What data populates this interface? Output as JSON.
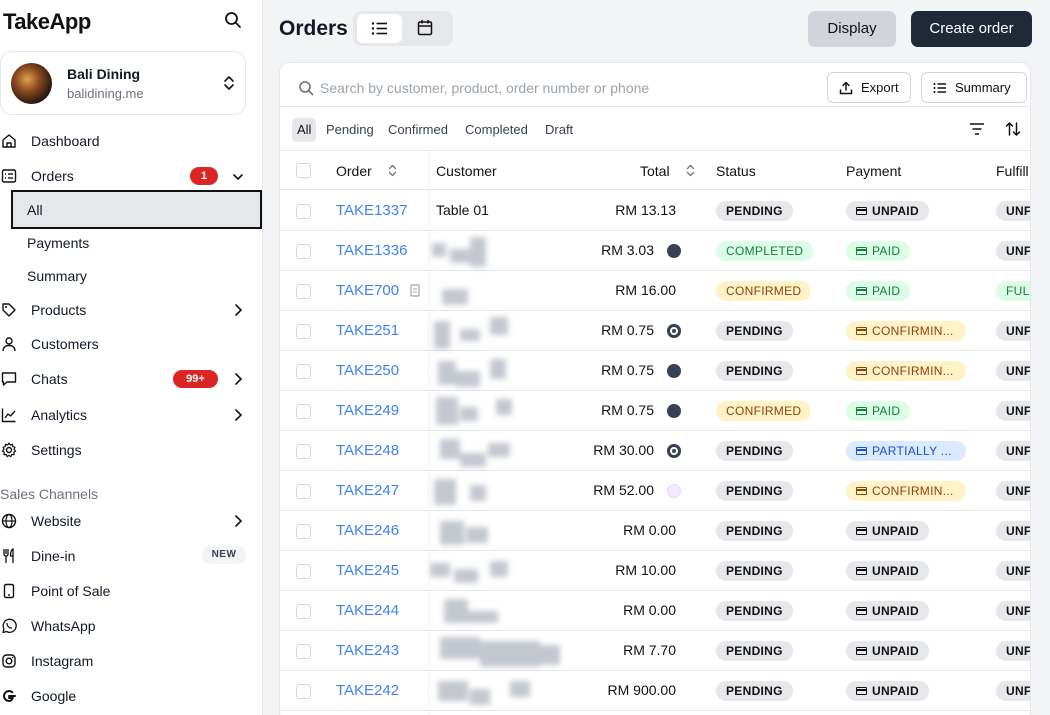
{
  "app": {
    "name": "TakeApp"
  },
  "store": {
    "name": "Bali Dining",
    "url": "balidining.me"
  },
  "nav": {
    "dashboard": "Dashboard",
    "orders": "Orders",
    "orders_badge": "1",
    "orders_sub": {
      "all": "All",
      "payments": "Payments",
      "summary": "Summary"
    },
    "products": "Products",
    "customers": "Customers",
    "chats": "Chats",
    "chats_badge": "99+",
    "analytics": "Analytics",
    "settings": "Settings"
  },
  "sales_channels": {
    "label": "Sales Channels",
    "website": "Website",
    "dinein": "Dine-in",
    "dinein_badge": "NEW",
    "pos": "Point of Sale",
    "whatsapp": "WhatsApp",
    "instagram": "Instagram",
    "google": "Google"
  },
  "header": {
    "title": "Orders",
    "display_label": "Display",
    "create_label": "Create order"
  },
  "search": {
    "placeholder": "Search by customer, product, order number or phone"
  },
  "toolbar": {
    "export_label": "Export",
    "summary_label": "Summary"
  },
  "filters": [
    "All",
    "Pending",
    "Confirmed",
    "Completed",
    "Draft"
  ],
  "columns": {
    "order": "Order",
    "customer": "Customer",
    "total": "Total",
    "status": "Status",
    "payment": "Payment",
    "fulfillment": "Fulfill"
  },
  "orders": [
    {
      "id": "TAKE1337",
      "customer": "Table 01",
      "total": "RM 13.13",
      "pm": "",
      "status": "PENDING",
      "payment": "UNPAID",
      "fulfillment": "UNF"
    },
    {
      "id": "TAKE1336",
      "customer": "",
      "total": "RM 3.03",
      "pm": "dark",
      "status": "COMPLETED",
      "payment": "PAID",
      "fulfillment": "UNF"
    },
    {
      "id": "TAKE700",
      "customer": "",
      "total": "RM 16.00",
      "pm": "",
      "status": "CONFIRMED",
      "payment": "PAID",
      "fulfillment": "FUL"
    },
    {
      "id": "TAKE251",
      "customer": "",
      "total": "RM 0.75",
      "pm": "eye",
      "status": "PENDING",
      "payment": "CONFIRMIN...",
      "fulfillment": "UNF"
    },
    {
      "id": "TAKE250",
      "customer": "",
      "total": "RM 0.75",
      "pm": "dark",
      "status": "PENDING",
      "payment": "CONFIRMIN...",
      "fulfillment": "UNF"
    },
    {
      "id": "TAKE249",
      "customer": "",
      "total": "RM 0.75",
      "pm": "dark",
      "status": "CONFIRMED",
      "payment": "PAID",
      "fulfillment": "UNF"
    },
    {
      "id": "TAKE248",
      "customer": "",
      "total": "RM 30.00",
      "pm": "eye",
      "status": "PENDING",
      "payment": "PARTIALLY ...",
      "fulfillment": "UNF"
    },
    {
      "id": "TAKE247",
      "customer": "",
      "total": "RM 52.00",
      "pm": "purple",
      "status": "PENDING",
      "payment": "CONFIRMIN...",
      "fulfillment": "UNF"
    },
    {
      "id": "TAKE246",
      "customer": "",
      "total": "RM 0.00",
      "pm": "",
      "status": "PENDING",
      "payment": "UNPAID",
      "fulfillment": "UNF"
    },
    {
      "id": "TAKE245",
      "customer": "",
      "total": "RM 10.00",
      "pm": "",
      "status": "PENDING",
      "payment": "UNPAID",
      "fulfillment": "UNF"
    },
    {
      "id": "TAKE244",
      "customer": "",
      "total": "RM 0.00",
      "pm": "",
      "status": "PENDING",
      "payment": "UNPAID",
      "fulfillment": "UNF"
    },
    {
      "id": "TAKE243",
      "customer": "",
      "total": "RM 7.70",
      "pm": "",
      "status": "PENDING",
      "payment": "UNPAID",
      "fulfillment": "UNF"
    },
    {
      "id": "TAKE242",
      "customer": "",
      "total": "RM 900.00",
      "pm": "",
      "status": "PENDING",
      "payment": "UNPAID",
      "fulfillment": "UNF"
    }
  ],
  "colors": {
    "link": "#3b82f6",
    "primary_btn": "#1f2937",
    "badge_red": "#dc2626"
  }
}
